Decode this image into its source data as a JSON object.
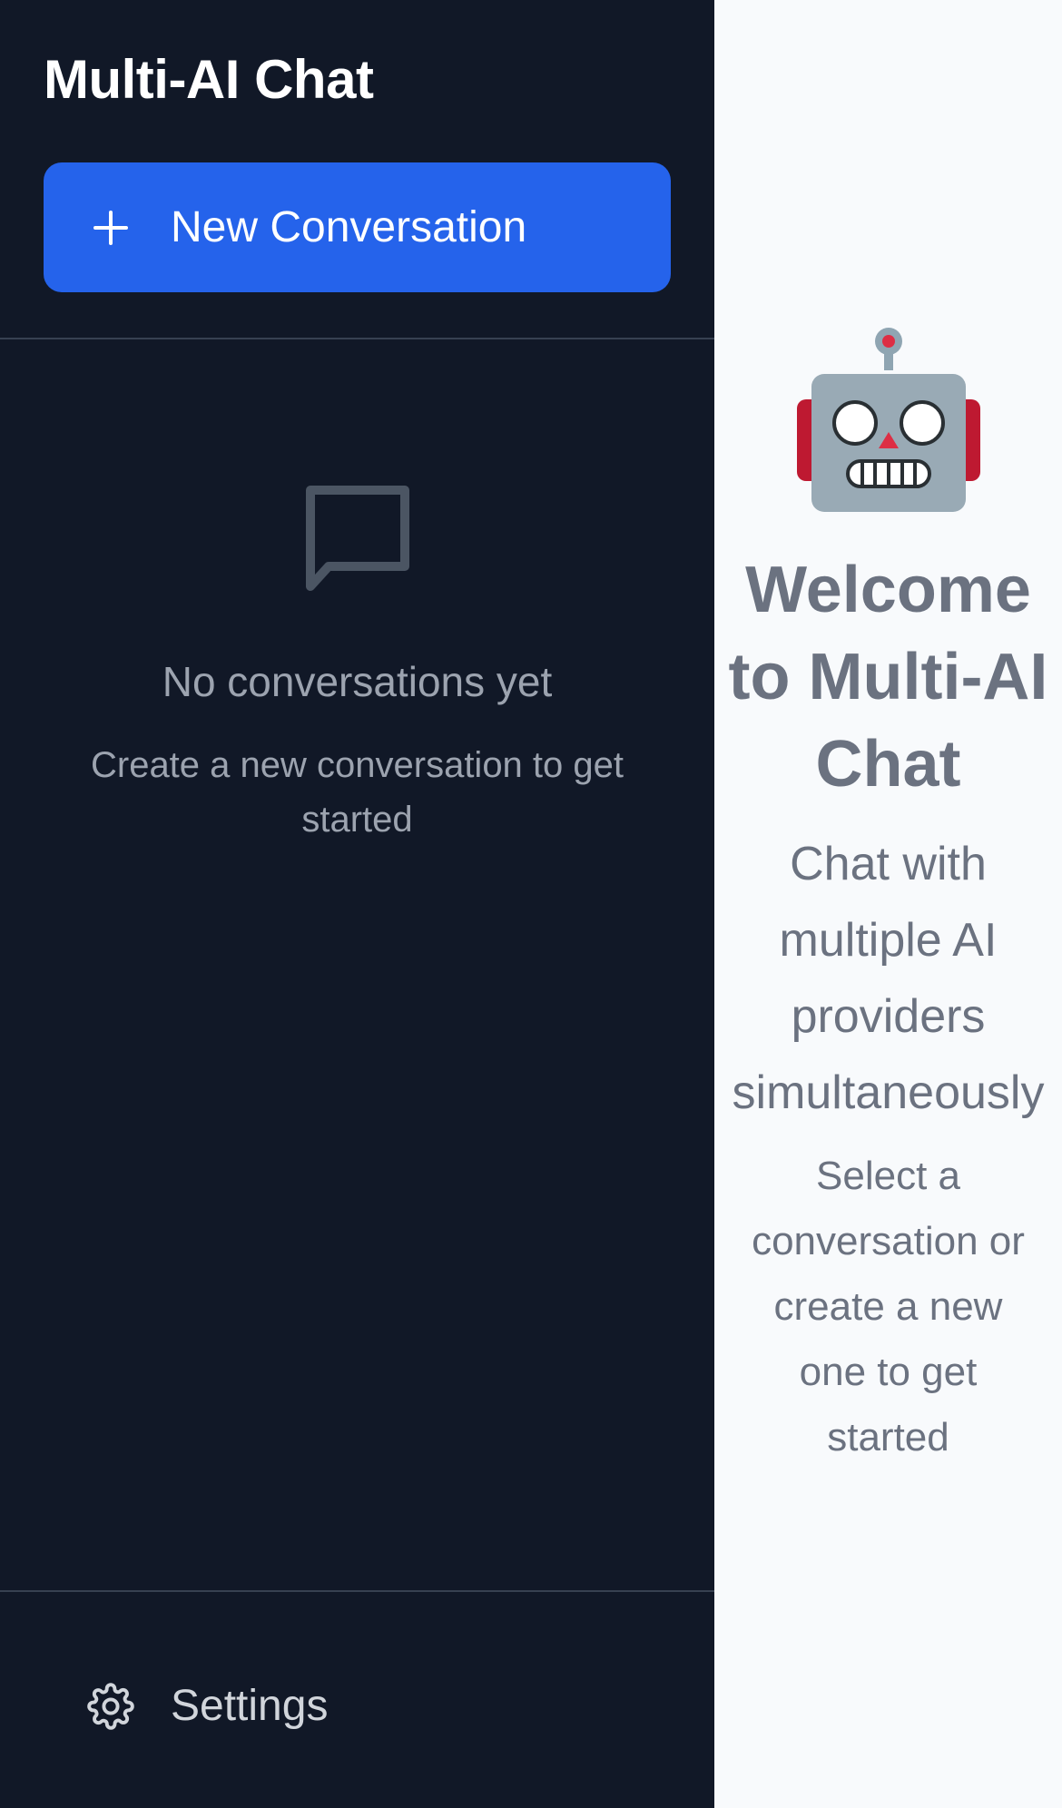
{
  "sidebar": {
    "title": "Multi-AI Chat",
    "new_conversation_label": "New Conversation",
    "empty_state": {
      "icon": "message-square-icon",
      "title": "No conversations yet",
      "subtitle": "Create a new conversation to get started"
    },
    "settings_label": "Settings"
  },
  "main": {
    "welcome_icon": "robot-emoji",
    "welcome_title": "Welcome to Multi-AI Chat",
    "subtitle_lines": [
      "Chat with",
      "multiple AI",
      "providers",
      "simultaneously"
    ],
    "hint_lines": [
      "Select a",
      "conversation or",
      "create a new",
      "one to get",
      "started"
    ]
  },
  "colors": {
    "sidebar_bg": "#111827",
    "accent": "#2563eb",
    "main_bg": "#f8fafc",
    "muted_text": "#9ca3af",
    "welcome_text": "#6b7280"
  }
}
